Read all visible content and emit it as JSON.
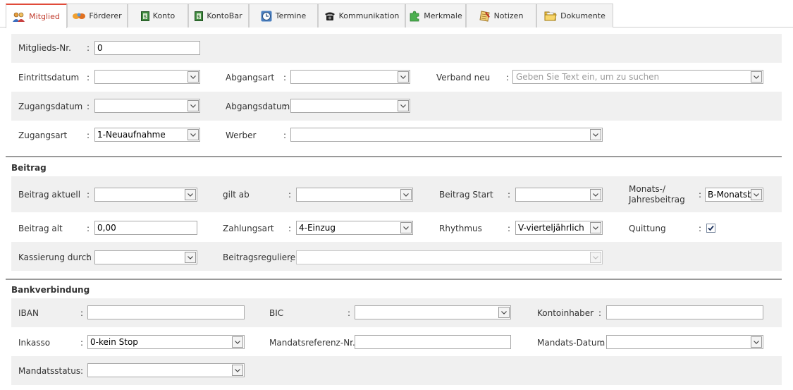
{
  "tabs": [
    {
      "label": "Mitglied",
      "icon": "people-icon",
      "active": true
    },
    {
      "label": "Förderer",
      "icon": "handshake-icon",
      "active": false
    },
    {
      "label": "Konto",
      "icon": "money-icon",
      "active": false
    },
    {
      "label": "KontoBar",
      "icon": "money-icon",
      "active": false
    },
    {
      "label": "Termine",
      "icon": "clock-icon",
      "active": false
    },
    {
      "label": "Kommunikation",
      "icon": "telephone-icon",
      "active": false
    },
    {
      "label": "Merkmale",
      "icon": "puzzle-icon",
      "active": false
    },
    {
      "label": "Notizen",
      "icon": "notepad-icon",
      "active": false
    },
    {
      "label": "Dokumente",
      "icon": "folder-icon",
      "active": false
    }
  ],
  "mitglied": {
    "mitgliedsnr": {
      "label": "Mitglieds-Nr.",
      "value": "0"
    },
    "eintrittsdatum": {
      "label": "Eintrittsdatum",
      "value": ""
    },
    "abgangsart": {
      "label": "Abgangsart",
      "value": ""
    },
    "verband_neu": {
      "label": "Verband neu",
      "value": "",
      "placeholder": "Geben Sie Text ein, um zu suchen"
    },
    "zugangsdatum": {
      "label": "Zugangsdatum",
      "value": ""
    },
    "abgangsdatum": {
      "label": "Abgangsdatum",
      "value": ""
    },
    "zugangsart": {
      "label": "Zugangsart",
      "value": "1-Neuaufnahme"
    },
    "werber": {
      "label": "Werber",
      "value": ""
    }
  },
  "beitrag": {
    "title": "Beitrag",
    "beitrag_aktuell": {
      "label": "Beitrag aktuell",
      "value": ""
    },
    "gilt_ab": {
      "label": "gilt ab",
      "value": ""
    },
    "beitrag_start": {
      "label": "Beitrag Start",
      "value": ""
    },
    "monats_label_1": "Monats-/",
    "monats_label_2": "Jahresbeitrag",
    "monats_value": "B-Monatsb",
    "beitrag_alt": {
      "label": "Beitrag alt",
      "value": "0,00"
    },
    "zahlungsart": {
      "label": "Zahlungsart",
      "value": "4-Einzug"
    },
    "rhythmus": {
      "label": "Rhythmus",
      "value": "V-vierteljährlich"
    },
    "quittung": {
      "label": "Quittung",
      "checked": true
    },
    "kassierung": {
      "label": "Kassierung durch",
      "value": ""
    },
    "beitragsregulierer": {
      "label": "Beitragsregulierer",
      "value": ""
    }
  },
  "bank": {
    "title": "Bankverbindung",
    "iban": {
      "label": "IBAN",
      "value": ""
    },
    "bic": {
      "label": "BIC",
      "value": ""
    },
    "kontoinhaber": {
      "label": "Kontoinhaber",
      "value": ""
    },
    "inkasso": {
      "label": "Inkasso",
      "value": "0-kein Stop"
    },
    "mandatsreferenz": {
      "label": "Mandatsreferenz-Nr.",
      "value": ""
    },
    "mandatsdatum": {
      "label": "Mandats-Datum",
      "value": ""
    },
    "mandatsstatus": {
      "label": "Mandatsstatus",
      "value": ""
    }
  },
  "colon": ":",
  "colors": {
    "active_tab": "#c0392b",
    "panel": "#f0f0f0",
    "separator": "#9a9a9a"
  }
}
